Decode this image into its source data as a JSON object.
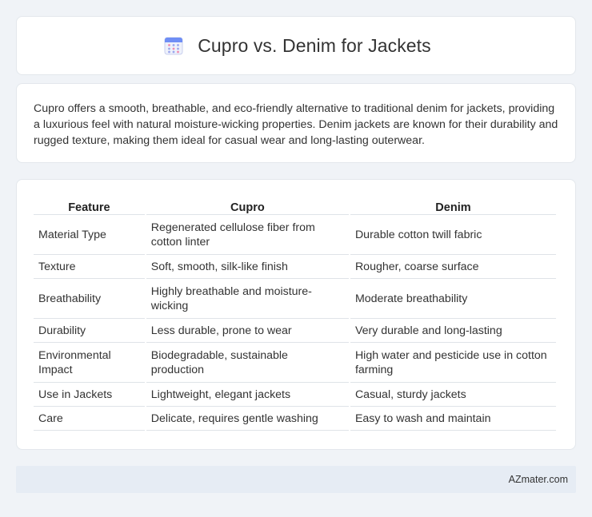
{
  "header": {
    "title": "Cupro vs. Denim for Jackets",
    "icon": "calendar-icon"
  },
  "intro": {
    "text": "Cupro offers a smooth, breathable, and eco-friendly alternative to traditional denim for jackets, providing a luxurious feel with natural moisture-wicking properties. Denim jackets are known for their durability and rugged texture, making them ideal for casual wear and long-lasting outerwear."
  },
  "table": {
    "headers": [
      "Feature",
      "Cupro",
      "Denim"
    ],
    "rows": [
      [
        "Material Type",
        "Regenerated cellulose fiber from cotton linter",
        "Durable cotton twill fabric"
      ],
      [
        "Texture",
        "Soft, smooth, silk-like finish",
        "Rougher, coarse surface"
      ],
      [
        "Breathability",
        "Highly breathable and moisture-wicking",
        "Moderate breathability"
      ],
      [
        "Durability",
        "Less durable, prone to wear",
        "Very durable and long-lasting"
      ],
      [
        "Environmental Impact",
        "Biodegradable, sustainable production",
        "High water and pesticide use in cotton farming"
      ],
      [
        "Use in Jackets",
        "Lightweight, elegant jackets",
        "Casual, sturdy jackets"
      ],
      [
        "Care",
        "Delicate, requires gentle washing",
        "Easy to wash and maintain"
      ]
    ]
  },
  "footer": {
    "text": "AZmater.com"
  }
}
